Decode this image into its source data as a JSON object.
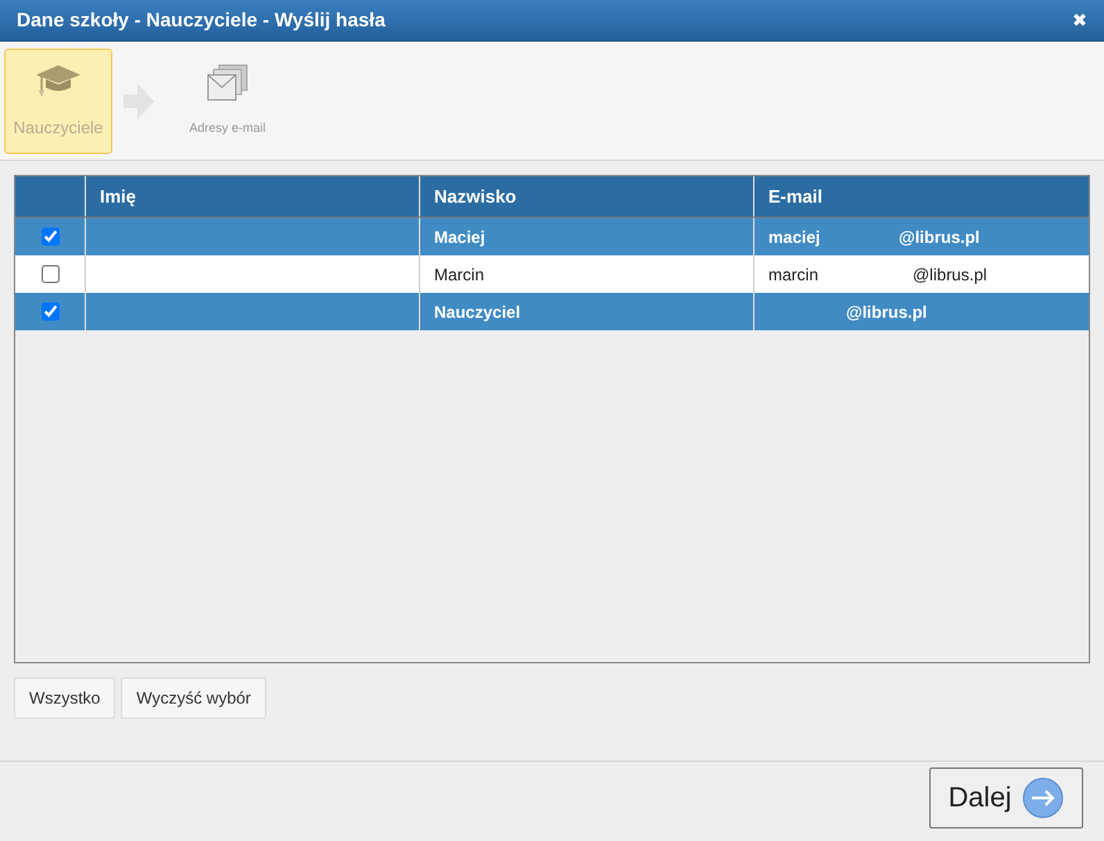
{
  "window": {
    "title": "Dane szkoły - Nauczyciele - Wyślij hasła",
    "close": "✖"
  },
  "steps": [
    {
      "label": "Nauczyciele",
      "kind": "teachers",
      "selected": true
    },
    {
      "label": "Adresy e-mail",
      "kind": "emails",
      "selected": false
    }
  ],
  "table": {
    "columns": [
      "Imię",
      "Nazwisko",
      "E-mail"
    ],
    "rows": [
      {
        "checked": true,
        "surname": "Maciej",
        "email_user": "maciej",
        "email_domain": "@librus.pl"
      },
      {
        "checked": false,
        "surname": "Marcin",
        "email_user": "marcin",
        "email_domain": "@librus.pl"
      },
      {
        "checked": true,
        "surname": "Nauczyciel",
        "email_domain": "@librus.pl"
      }
    ]
  },
  "selection_buttons": [
    "Wszystko",
    "Wyczyść wybór"
  ],
  "next_button": "Dalej"
}
